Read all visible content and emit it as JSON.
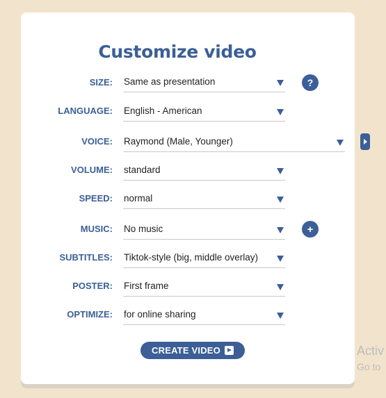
{
  "title": "Customize video",
  "rows": [
    {
      "label": "SIZE:",
      "value": "Same as presentation"
    },
    {
      "label": "LANGUAGE:",
      "value": "English - American"
    },
    {
      "label": "VOICE:",
      "value": "Raymond (Male, Younger)"
    },
    {
      "label": "VOLUME:",
      "value": "standard"
    },
    {
      "label": "SPEED:",
      "value": "normal"
    },
    {
      "label": "MUSIC:",
      "value": "No music"
    },
    {
      "label": "SUBTITLES:",
      "value": "Tiktok-style (big, middle overlay)"
    },
    {
      "label": "POSTER:",
      "value": "First frame"
    },
    {
      "label": "OPTIMIZE:",
      "value": "for online sharing"
    }
  ],
  "help_button": "?",
  "add_music_button": "+",
  "create_button": "CREATE VIDEO",
  "watermark": {
    "line1": "Activ",
    "line2": "Go to"
  },
  "colors": {
    "accent": "#3b5f96",
    "background": "#f2e4cc",
    "card": "#ffffff"
  }
}
